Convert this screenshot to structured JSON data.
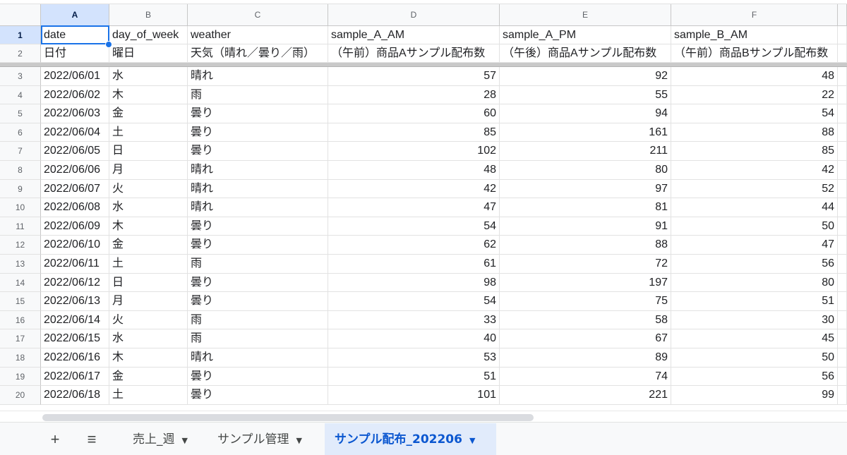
{
  "column_headers": [
    "A",
    "B",
    "C",
    "D",
    "E",
    "F"
  ],
  "selected_cell": "A1",
  "rows": [
    {
      "n": "1",
      "cells": [
        "date",
        "day_of_week",
        "weather",
        "sample_A_AM",
        "sample_A_PM",
        "sample_B_AM"
      ]
    },
    {
      "n": "2",
      "cells": [
        "日付",
        "曜日",
        "天気（晴れ／曇り／雨）",
        "（午前）商品Aサンプル配布数",
        "（午後）商品Aサンプル配布数",
        "（午前）商品Bサンプル配布数"
      ]
    },
    {
      "n": "3",
      "cells": [
        "2022/06/01",
        "水",
        "晴れ",
        "57",
        "92",
        "48"
      ]
    },
    {
      "n": "4",
      "cells": [
        "2022/06/02",
        "木",
        "雨",
        "28",
        "55",
        "22"
      ]
    },
    {
      "n": "5",
      "cells": [
        "2022/06/03",
        "金",
        "曇り",
        "60",
        "94",
        "54"
      ]
    },
    {
      "n": "6",
      "cells": [
        "2022/06/04",
        "土",
        "曇り",
        "85",
        "161",
        "88"
      ]
    },
    {
      "n": "7",
      "cells": [
        "2022/06/05",
        "日",
        "曇り",
        "102",
        "211",
        "85"
      ]
    },
    {
      "n": "8",
      "cells": [
        "2022/06/06",
        "月",
        "晴れ",
        "48",
        "80",
        "42"
      ]
    },
    {
      "n": "9",
      "cells": [
        "2022/06/07",
        "火",
        "晴れ",
        "42",
        "97",
        "52"
      ]
    },
    {
      "n": "10",
      "cells": [
        "2022/06/08",
        "水",
        "晴れ",
        "47",
        "81",
        "44"
      ]
    },
    {
      "n": "11",
      "cells": [
        "2022/06/09",
        "木",
        "曇り",
        "54",
        "91",
        "50"
      ]
    },
    {
      "n": "12",
      "cells": [
        "2022/06/10",
        "金",
        "曇り",
        "62",
        "88",
        "47"
      ]
    },
    {
      "n": "13",
      "cells": [
        "2022/06/11",
        "土",
        "雨",
        "61",
        "72",
        "56"
      ]
    },
    {
      "n": "14",
      "cells": [
        "2022/06/12",
        "日",
        "曇り",
        "98",
        "197",
        "80"
      ]
    },
    {
      "n": "15",
      "cells": [
        "2022/06/13",
        "月",
        "曇り",
        "54",
        "75",
        "51"
      ]
    },
    {
      "n": "16",
      "cells": [
        "2022/06/14",
        "火",
        "雨",
        "33",
        "58",
        "30"
      ]
    },
    {
      "n": "17",
      "cells": [
        "2022/06/15",
        "水",
        "雨",
        "40",
        "67",
        "45"
      ]
    },
    {
      "n": "18",
      "cells": [
        "2022/06/16",
        "木",
        "晴れ",
        "53",
        "89",
        "50"
      ]
    },
    {
      "n": "19",
      "cells": [
        "2022/06/17",
        "金",
        "曇り",
        "51",
        "74",
        "56"
      ]
    },
    {
      "n": "20",
      "cells": [
        "2022/06/18",
        "土",
        "曇り",
        "101",
        "221",
        "99"
      ]
    }
  ],
  "numeric_columns": [
    3,
    4,
    5
  ],
  "sheet_bar": {
    "add_icon": "plus-icon",
    "all_sheets_icon": "menu-icon",
    "tabs": [
      {
        "label": "売上_週",
        "active": false
      },
      {
        "label": "サンプル管理",
        "active": false
      },
      {
        "label": "サンプル配布_202206",
        "active": true
      }
    ]
  },
  "colors": {
    "accent": "#1a73e8",
    "active_tab_bg": "#e1ebfb",
    "active_tab_text": "#0b57d0",
    "header_bg": "#f8f9fa"
  }
}
